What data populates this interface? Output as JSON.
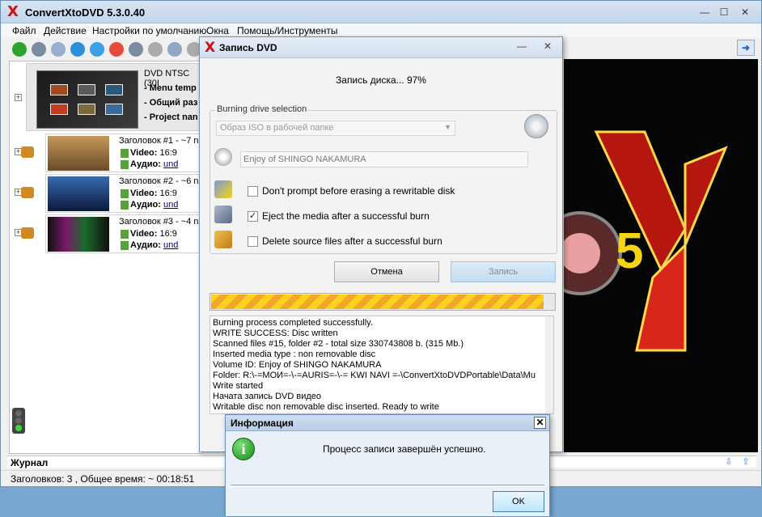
{
  "main_window": {
    "title": "ConvertXtoDVD 5.3.0.40",
    "logo_glyph": "X",
    "controls": {
      "minimize": "—",
      "maximize": "☐",
      "close": "✕"
    }
  },
  "menu": [
    "Файл",
    "Действие",
    "Настройки по умолчанию",
    "Окна",
    "Помощь/Инструменты"
  ],
  "toolbar": {
    "icons": [
      "add-icon",
      "save-icon",
      "convert-icon",
      "download-icon",
      "upload-icon",
      "delete-icon",
      "link-icon",
      "grid-icon",
      "screen-icon",
      "settings-icon"
    ],
    "colors": [
      "#2fa32f",
      "#7a8aa0",
      "#9aaed0",
      "#2d8fd8",
      "#3aa0e8",
      "#e84a3a",
      "#7a8aa0",
      "#aaaaaa",
      "#8fa6c4",
      "#aaaaaa"
    ]
  },
  "title_list": {
    "dvd": {
      "name": "DVD NTSC (30I",
      "menu_line": "- Menu temp",
      "size_line": "- Общий раз",
      "project_line": "- Project nan"
    },
    "titles": [
      {
        "heading": "Заголовок #1 - ~7 n",
        "video_label": "Video:",
        "video_value": "16:9",
        "audio_label": "Аудио:",
        "audio_value": "und"
      },
      {
        "heading": "Заголовок #2 - ~6 n",
        "video_label": "Video:",
        "video_value": "16:9",
        "audio_label": "Аудио:",
        "audio_value": "und"
      },
      {
        "heading": "Заголовок #3 - ~4 n",
        "video_label": "Video:",
        "video_value": "16:9",
        "audio_label": "Аудио:",
        "audio_value": "und"
      }
    ],
    "thumb_colors": [
      "#b8864a",
      "#1a3a6a",
      "#101010"
    ]
  },
  "preview": {
    "logo_digit": "5",
    "accent_color": "#e3241b"
  },
  "journal": {
    "label": "Журнал"
  },
  "status": {
    "text": "Заголовков: 3 , Общее время: ~ 00:18:51"
  },
  "burn_dialog": {
    "title": "Запись DVD",
    "progress_text": "Запись диска... 97%",
    "progress_percent": 97,
    "drive_section_label": "Burning drive selection",
    "drive_selected": "Образ ISO в рабочей папке",
    "volume_value": "Enjoy of SHINGO NAKAMURA",
    "options": [
      {
        "label": "Don't prompt before erasing a rewritable disk",
        "checked": false
      },
      {
        "label": "Eject the media after a successful burn",
        "checked": true
      },
      {
        "label": "Delete source files after a successful burn",
        "checked": false
      }
    ],
    "cancel_label": "Отмена",
    "burn_label": "Запись",
    "log": [
      "Burning process completed successfully.",
      "WRITE SUCCESS: Disc written",
      "Scanned files #15, folder #2 - total size 330743808 b. (315 Mb.)",
      "Inserted media type : non removable disc",
      "Volume ID: Enjoy of SHINGO NAKAMURA",
      "Folder: R:\\-=МОИ=-\\-=AURIS=-\\-= KWI NAVI =-\\ConvertXtoDVDPortable\\Data\\Mu",
      "Write started",
      "Начата запись DVD видео",
      "Writable disc non removable disc inserted. Ready to write"
    ]
  },
  "info_dialog": {
    "title": "Информация",
    "icon_glyph": "i",
    "message": "Процесс записи завершён успешно.",
    "ok_label": "OK",
    "close_glyph": "✕"
  }
}
